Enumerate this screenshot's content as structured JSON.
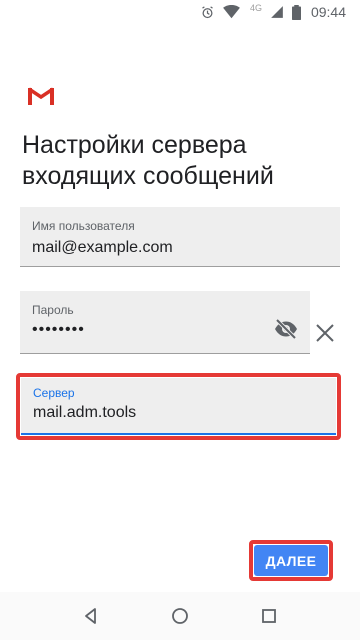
{
  "status_bar": {
    "network": "4G",
    "time": "09:44",
    "icons": [
      "alarm-icon",
      "wifi-icon",
      "signal-icon",
      "battery-icon"
    ]
  },
  "app": {
    "logo": "gmail-logo",
    "title": "Настройки сервера входящих сообщений"
  },
  "form": {
    "username": {
      "label": "Имя пользователя",
      "value": "mail@example.com"
    },
    "password": {
      "label": "Пароль",
      "value": "••••••••"
    },
    "server": {
      "label": "Сервер",
      "value": "mail.adm.tools"
    }
  },
  "actions": {
    "next_label": "ДАЛЕЕ"
  },
  "nav": {
    "icons": [
      "back-icon",
      "home-icon",
      "recents-icon"
    ]
  },
  "colors": {
    "accent": "#4285f4",
    "focus_label": "#1a73e8",
    "highlight": "#e53935",
    "gmail_red": "#d93025"
  }
}
